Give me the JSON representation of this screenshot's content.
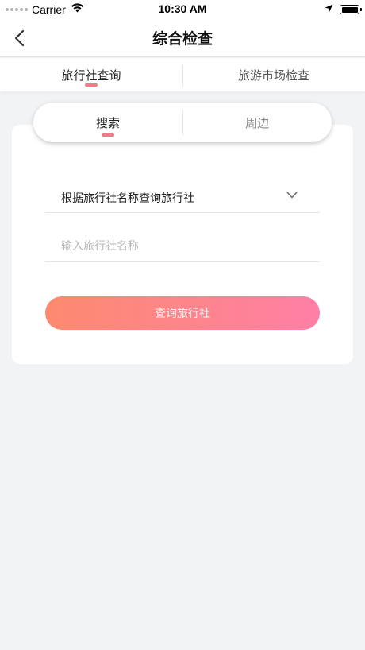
{
  "status_bar": {
    "carrier": "Carrier",
    "time": "10:30 AM"
  },
  "nav": {
    "title": "综合检查",
    "back_icon": "chevron-left-icon"
  },
  "top_tabs": [
    {
      "label": "旅行社查询",
      "active": true
    },
    {
      "label": "旅游市场检查",
      "active": false
    }
  ],
  "segment": [
    {
      "label": "搜索",
      "active": true
    },
    {
      "label": "周边",
      "active": false
    }
  ],
  "form": {
    "search_type": "根据旅行社名称查询旅行社",
    "name_placeholder": "输入旅行社名称",
    "name_value": "",
    "submit_label": "查询旅行社"
  },
  "colors": {
    "accent": "#f07a8a",
    "button_gradient_start": "#fd8a6e",
    "button_gradient_end": "#ff7fa6",
    "background": "#f2f3f5"
  }
}
